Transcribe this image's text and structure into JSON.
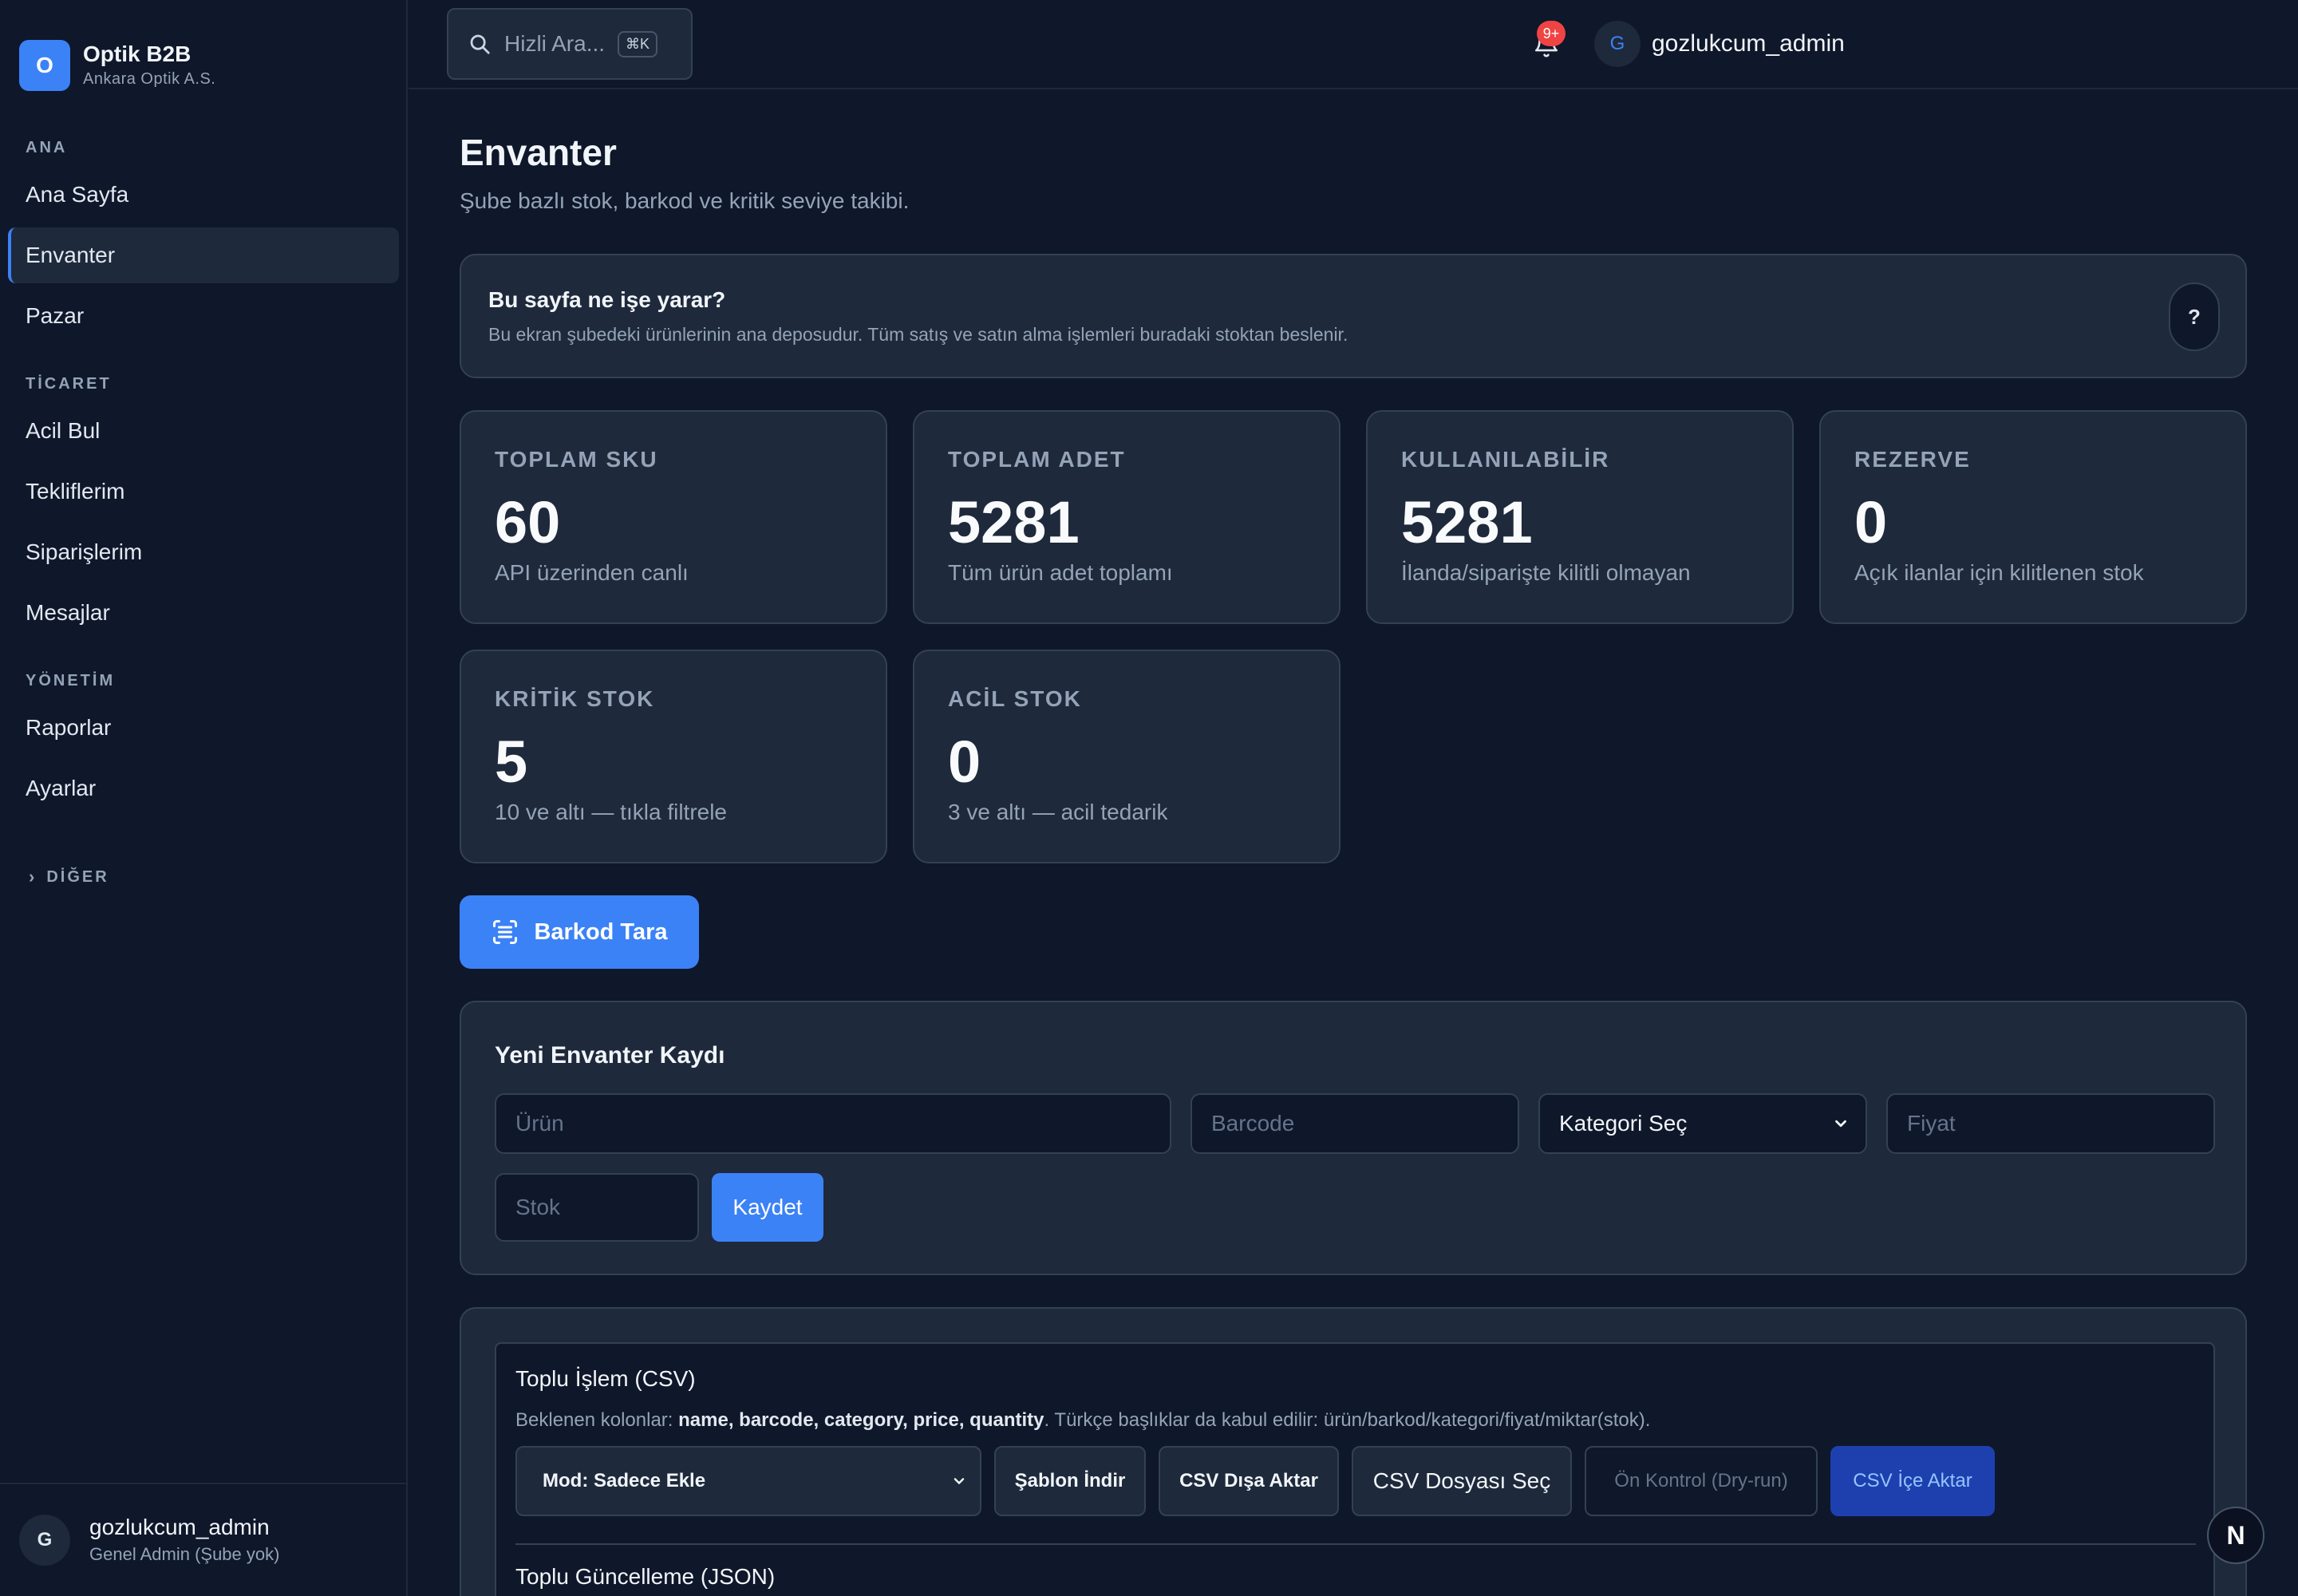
{
  "brand": {
    "logo_letter": "O",
    "name": "Optik B2B",
    "subtitle": "Ankara Optik A.S."
  },
  "sidebar": {
    "sections": {
      "ana": "ANA",
      "ticaret": "TİCARET",
      "yonetim": "YÖNETİM",
      "diger": "DİĞER"
    },
    "items": {
      "ana_sayfa": "Ana Sayfa",
      "envanter": "Envanter",
      "pazar": "Pazar",
      "acil_bul": "Acil Bul",
      "tekliflerim": "Tekliflerim",
      "siparislerim": "Siparişlerim",
      "mesajlar": "Mesajlar",
      "raporlar": "Raporlar",
      "ayarlar": "Ayarlar"
    },
    "active": "Envanter",
    "user": {
      "avatar_letter": "G",
      "name": "gozlukcum_admin",
      "role": "Genel Admin (Şube yok)"
    }
  },
  "topbar": {
    "search_placeholder": "Hizli Ara...",
    "shortcut": "⌘K",
    "notification_badge": "9+",
    "user_avatar_letter": "G",
    "username": "gozlukcum_admin"
  },
  "page": {
    "title": "Envanter",
    "subtitle": "Şube bazlı stok, barkod ve kritik seviye takibi."
  },
  "help": {
    "title": "Bu sayfa ne işe yarar?",
    "text": "Bu ekran şubedeki ürünlerinin ana deposudur. Tüm satış ve satın alma işlemleri buradaki stoktan beslenir.",
    "button": "?"
  },
  "stats": [
    {
      "label": "TOPLAM SKU",
      "value": "60",
      "desc": "API üzerinden canlı"
    },
    {
      "label": "TOPLAM ADET",
      "value": "5281",
      "desc": "Tüm ürün adet toplamı"
    },
    {
      "label": "KULLANILABİLİR",
      "value": "5281",
      "desc": "İlanda/siparişte kilitli olmayan"
    },
    {
      "label": "REZERVE",
      "value": "0",
      "desc": "Açık ilanlar için kilitlenen stok"
    },
    {
      "label": "KRİTİK STOK",
      "value": "5",
      "desc": "10 ve altı — tıkla filtrele"
    },
    {
      "label": "ACİL STOK",
      "value": "0",
      "desc": "3 ve altı — acil tedarik"
    }
  ],
  "barcode_button": "Barkod Tara",
  "new_entry": {
    "title": "Yeni Envanter Kaydı",
    "product_placeholder": "Ürün",
    "barcode_placeholder": "Barcode",
    "category_selected": "Kategori Seç",
    "price_placeholder": "Fiyat",
    "stock_placeholder": "Stok",
    "save_label": "Kaydet"
  },
  "bulk": {
    "title": "Toplu İşlem (CSV)",
    "cols_prefix": "Beklenen kolonlar: ",
    "cols_list": "name, barcode, category, price, quantity",
    "cols_suffix": ". Türkçe başlıklar da kabul edilir: ürün/barkod/kategori/fiyat/miktar(stok).",
    "mode_selected": "Mod: Sadece Ekle",
    "template_button": "Şablon İndir",
    "export_button": "CSV Dışa Aktar",
    "choose_file_button": "CSV Dosyası Seç",
    "dry_run_button": "Ön Kontrol (Dry-run)",
    "import_button": "CSV İçe Aktar",
    "json_title": "Toplu Güncelleme (JSON)"
  },
  "floating_badge": "N",
  "colors": {
    "accent": "#3b82f6",
    "background": "#0f172a",
    "card": "#1e293b",
    "badge": "#ef4444"
  }
}
